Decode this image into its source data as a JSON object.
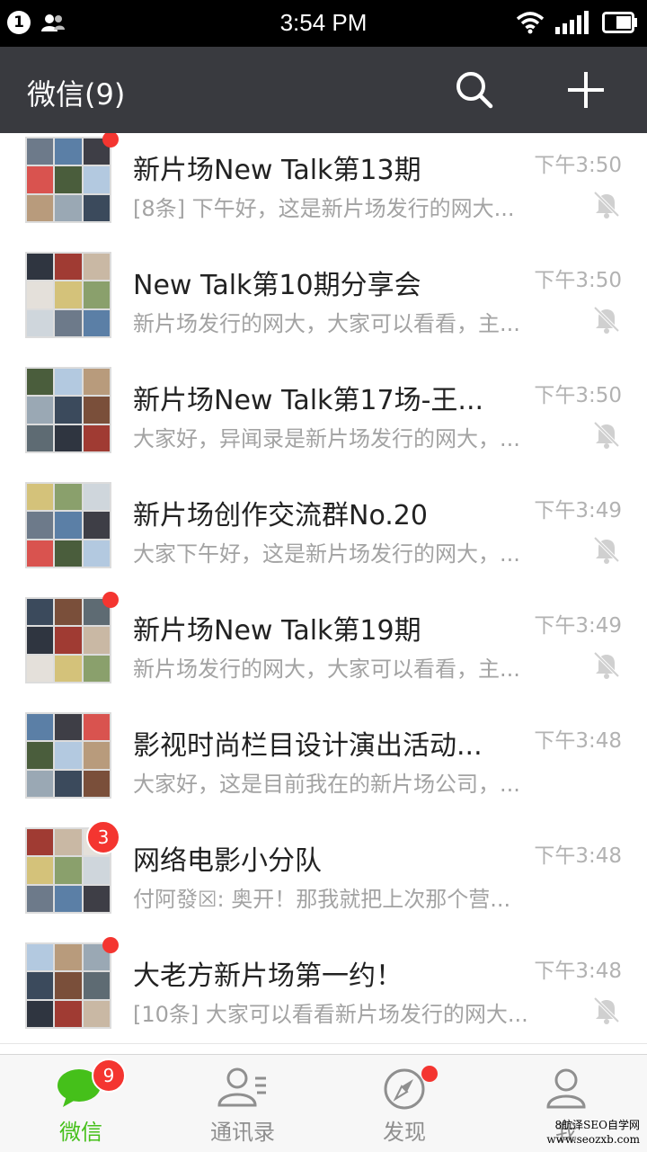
{
  "status_bar": {
    "notification_count": "1",
    "time": "3:54 PM"
  },
  "header": {
    "title": "微信(9)"
  },
  "chats": [
    {
      "title": "新片场New Talk第13期",
      "time": "下午3:50",
      "preview": "[8条] 下午好，这是新片场发行的网大...",
      "muted": true,
      "unread_dot": true,
      "badge": ""
    },
    {
      "title": "New Talk第10期分享会",
      "time": "下午3:50",
      "preview": "新片场发行的网大，大家可以看看，主...",
      "muted": true,
      "unread_dot": false,
      "badge": ""
    },
    {
      "title": "新片场New Talk第17场-王...",
      "time": "下午3:50",
      "preview": "大家好，异闻录是新片场发行的网大，...",
      "muted": true,
      "unread_dot": false,
      "badge": ""
    },
    {
      "title": "新片场创作交流群No.20",
      "time": "下午3:49",
      "preview": "大家下午好，这是新片场发行的网大，...",
      "muted": true,
      "unread_dot": false,
      "badge": ""
    },
    {
      "title": "新片场New Talk第19期",
      "time": "下午3:49",
      "preview": "新片场发行的网大，大家可以看看，主...",
      "muted": true,
      "unread_dot": true,
      "badge": ""
    },
    {
      "title": "影视时尚栏目设计演出活动...",
      "time": "下午3:48",
      "preview": "大家好，这是目前我在的新片场公司，...",
      "muted": false,
      "unread_dot": false,
      "badge": ""
    },
    {
      "title": "网络电影小分队",
      "time": "下午3:48",
      "preview": "付阿發☒: 奥开！那我就把上次那个营...",
      "muted": false,
      "unread_dot": false,
      "badge": "3"
    },
    {
      "title": "大老方新片场第一约！",
      "time": "下午3:48",
      "preview": "[10条] 大家可以看看新片场发行的网大...",
      "muted": true,
      "unread_dot": true,
      "badge": ""
    }
  ],
  "tabs": [
    {
      "label": "微信",
      "active": true,
      "badge": "9",
      "icon": "chat-bubble-icon"
    },
    {
      "label": "通讯录",
      "active": false,
      "badge": "",
      "icon": "contacts-icon"
    },
    {
      "label": "发现",
      "active": false,
      "badge": "",
      "icon": "compass-icon"
    },
    {
      "label": "我",
      "active": false,
      "badge": "",
      "icon": "person-icon"
    }
  ],
  "watermark": {
    "line1": "8航泽SEO自学网",
    "line2": "www.seozxb.com"
  },
  "colors": {
    "header_bg": "#393a3f",
    "accent_green": "#45c01a",
    "badge_red": "#f43530"
  }
}
